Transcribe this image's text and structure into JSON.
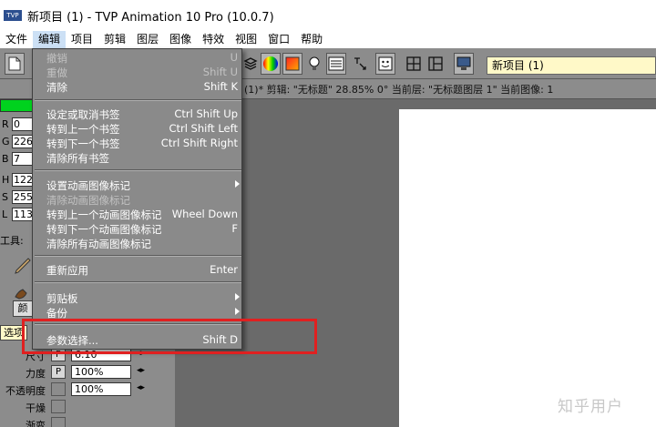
{
  "window": {
    "app_icon_text": "TVP",
    "title": "新项目 (1) - TVP Animation 10 Pro (10.0.7)"
  },
  "menubar": {
    "items": [
      "文件",
      "编辑",
      "项目",
      "剪辑",
      "图层",
      "图像",
      "特效",
      "视图",
      "窗口",
      "帮助"
    ]
  },
  "toolbar": {
    "project_name": "新项目 (1)"
  },
  "status": {
    "text": "(1)*  剪辑: \"无标题\"   28.85%   0°  当前层: \"无标题图层 1\"  当前图像: 1"
  },
  "color_panel": {
    "rows": [
      {
        "label": "R",
        "value": "0"
      },
      {
        "label": "G",
        "value": "226"
      },
      {
        "label": "B",
        "value": "7"
      },
      {
        "label": "H",
        "value": "122"
      },
      {
        "label": "S",
        "value": "255"
      },
      {
        "label": "L",
        "value": "113"
      }
    ],
    "tools_label": "工具:",
    "color_tab": "颜",
    "select_tab": "选项"
  },
  "params": [
    {
      "label": "尺寸",
      "button": "P",
      "value": "6.10"
    },
    {
      "label": "力度",
      "button": "P",
      "value": "100%"
    },
    {
      "label": "不透明度",
      "button": "",
      "value": "100%"
    },
    {
      "label": "干燥",
      "button": "",
      "value": ""
    },
    {
      "label": "渐变",
      "button": "",
      "value": ""
    }
  ],
  "edit_menu": {
    "items": [
      {
        "label": "撤销",
        "shortcut": "U",
        "disabled": true
      },
      {
        "label": "重做",
        "shortcut": "Shift U",
        "disabled": true
      },
      {
        "label": "清除",
        "shortcut": "Shift K",
        "disabled": false
      },
      {
        "label": "设定或取消书签",
        "shortcut": "Ctrl Shift Up",
        "disabled": false
      },
      {
        "label": "转到上一个书签",
        "shortcut": "Ctrl Shift Left",
        "disabled": false
      },
      {
        "label": "转到下一个书签",
        "shortcut": "Ctrl Shift Right",
        "disabled": false
      },
      {
        "label": "清除所有书签",
        "shortcut": "",
        "disabled": false
      },
      {
        "label": "设置动画图像标记",
        "shortcut": "",
        "disabled": false
      },
      {
        "label": "清除动画图像标记",
        "shortcut": "",
        "disabled": true
      },
      {
        "label": "转到上一个动画图像标记",
        "shortcut": "Wheel Down",
        "disabled": false
      },
      {
        "label": "转到下一个动画图像标记",
        "shortcut": "F",
        "disabled": false
      },
      {
        "label": "清除所有动画图像标记",
        "shortcut": "",
        "disabled": false
      },
      {
        "label": "重新应用",
        "shortcut": "Enter",
        "disabled": false
      },
      {
        "label": "剪贴板",
        "shortcut": "",
        "disabled": false
      },
      {
        "label": "备份",
        "shortcut": "",
        "disabled": false
      },
      {
        "label": "参数选择...",
        "shortcut": "Shift D",
        "disabled": false
      }
    ]
  },
  "watermark": "知乎用户",
  "colors": {
    "highlight": "#e02020",
    "swatch": "#00d21e",
    "menu_bg": "#8a8a8a"
  }
}
